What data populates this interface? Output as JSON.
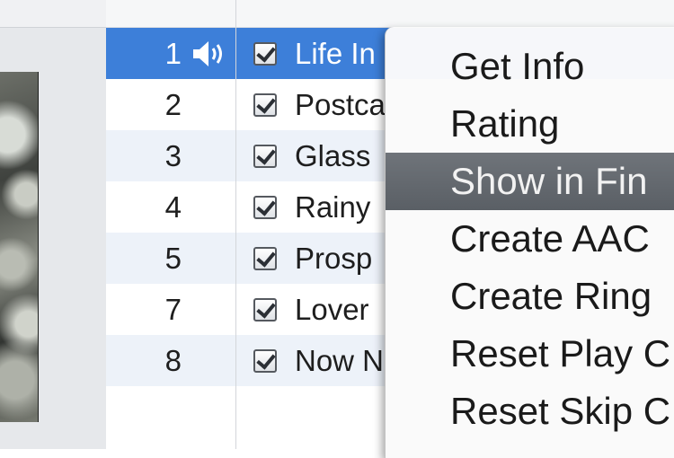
{
  "tracks": [
    {
      "number": "1",
      "title": "Life In",
      "checked": true,
      "playing": true,
      "selected": true
    },
    {
      "number": "2",
      "title": "Postca",
      "checked": true,
      "playing": false,
      "selected": false
    },
    {
      "number": "3",
      "title": "Glass",
      "checked": true,
      "playing": false,
      "selected": false
    },
    {
      "number": "4",
      "title": "Rainy",
      "checked": true,
      "playing": false,
      "selected": false
    },
    {
      "number": "5",
      "title": "Prosp",
      "checked": true,
      "playing": false,
      "selected": false
    },
    {
      "number": "7",
      "title": "Lover",
      "checked": true,
      "playing": false,
      "selected": false
    },
    {
      "number": "8",
      "title": "Now N",
      "checked": true,
      "playing": false,
      "selected": false
    }
  ],
  "context_menu": {
    "items": [
      {
        "label": "Get Info",
        "highlighted": false
      },
      {
        "label": "Rating",
        "highlighted": false
      },
      {
        "label": "Show in Fin",
        "highlighted": true
      },
      {
        "label": "Create AAC",
        "highlighted": false
      },
      {
        "label": "Create Ring",
        "highlighted": false
      },
      {
        "label": "Reset Play C",
        "highlighted": false
      },
      {
        "label": "Reset Skip C",
        "highlighted": false
      }
    ]
  },
  "colors": {
    "selection": "#3d7fd9",
    "menu_highlight": "#5f646a",
    "alt_row": "#edf2f9"
  },
  "icons": {
    "playing": "speaker-icon",
    "checkbox": "checkbox-icon"
  }
}
